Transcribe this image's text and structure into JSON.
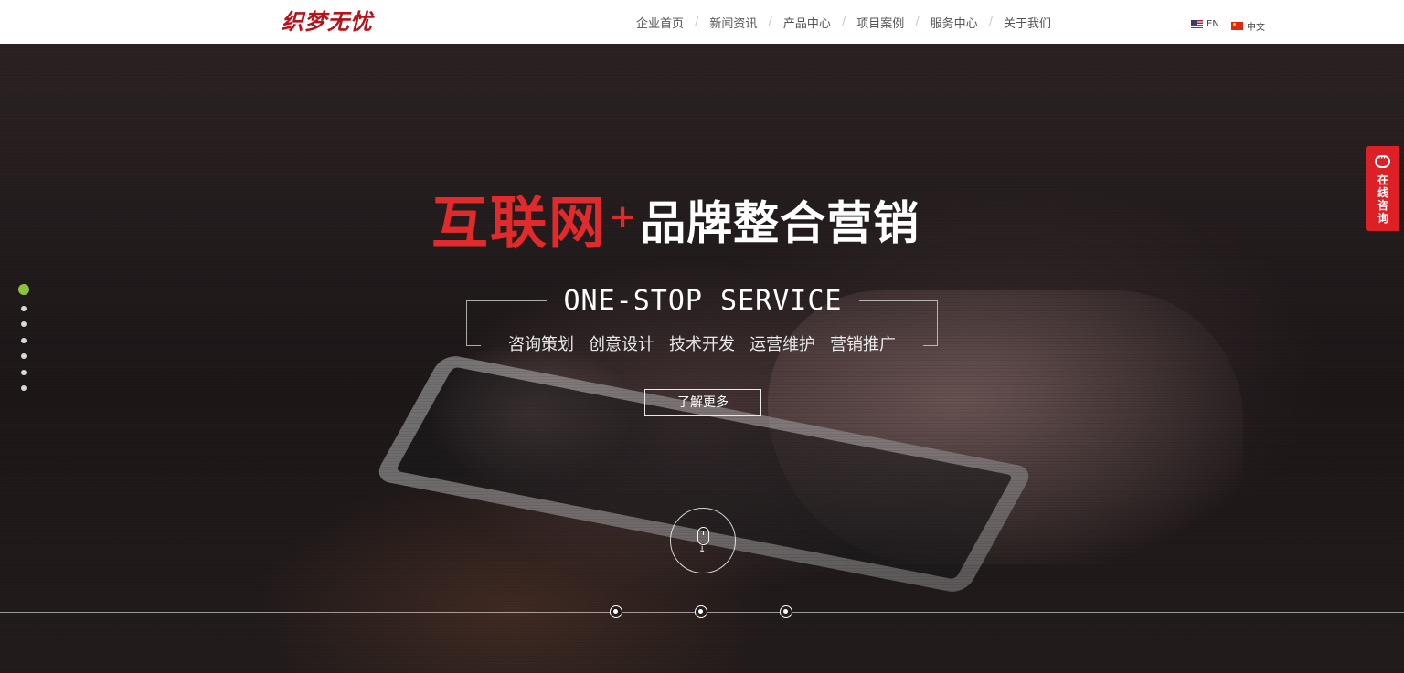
{
  "header": {
    "logo_text": "织梦无忧",
    "nav": [
      {
        "label": "企业首页"
      },
      {
        "label": "新闻资讯"
      },
      {
        "label": "产品中心"
      },
      {
        "label": "项目案例"
      },
      {
        "label": "服务中心"
      },
      {
        "label": "关于我们"
      }
    ],
    "nav_separator": "/",
    "lang": {
      "en": "EN",
      "zh": "中文"
    }
  },
  "hero": {
    "headline_red": "互联网",
    "headline_plus": "+",
    "headline_white": "品牌整合营销",
    "subtitle": "ONE-STOP SERVICE",
    "services": [
      "咨询策划",
      "创意设计",
      "技术开发",
      "运营维护",
      "营销推广"
    ],
    "more_label": "了解更多",
    "slides_total": 7,
    "active_slide": 1
  },
  "consult": {
    "label": "在线咨询"
  },
  "colors": {
    "accent_red": "#e02a2b",
    "logo_red": "#b5121b",
    "active_dot": "#8ac43f",
    "consult_bg": "#dd1f26"
  },
  "icons": [
    "us-flag-icon",
    "cn-flag-icon",
    "mouse-scroll-icon",
    "chat-bubble-icon"
  ]
}
